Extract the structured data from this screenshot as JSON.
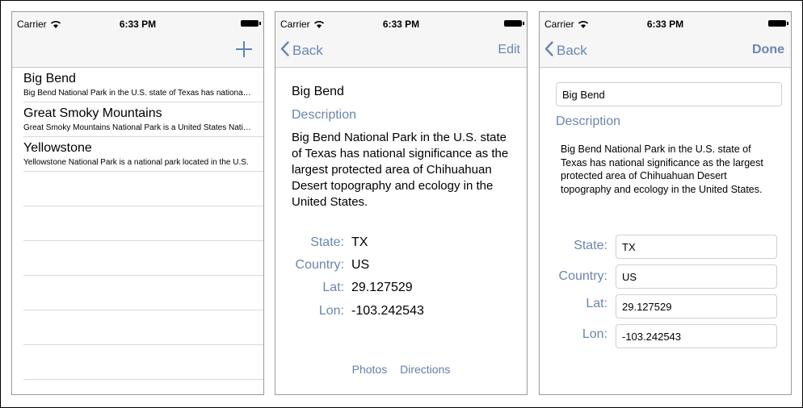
{
  "status": {
    "carrier": "Carrier",
    "time": "6:33 PM"
  },
  "list_screen": {
    "items": [
      {
        "title": "Big Bend",
        "subtitle": "Big Bend National Park in the U.S. state of Texas has national significance as the largest protected area"
      },
      {
        "title": "Great Smoky Mountains",
        "subtitle": "Great Smoky Mountains National Park is a United States National Park"
      },
      {
        "title": "Yellowstone",
        "subtitle": "Yellowstone National Park is a national park located in the U.S."
      }
    ]
  },
  "detail_screen": {
    "back_label": "Back",
    "edit_label": "Edit",
    "title": "Big Bend",
    "description_label": "Description",
    "description": "Big Bend National Park in the U.S. state of Texas has national significance as the largest protected area of Chihuahuan Desert topography and ecology in the United States.",
    "fields": [
      {
        "label": "State:",
        "value": "TX"
      },
      {
        "label": "Country:",
        "value": "US"
      },
      {
        "label": "Lat:",
        "value": "29.127529"
      },
      {
        "label": "Lon:",
        "value": "-103.242543"
      }
    ],
    "photos_label": "Photos",
    "directions_label": "Directions"
  },
  "edit_screen": {
    "back_label": "Back",
    "done_label": "Done",
    "name_value": "Big Bend",
    "description_label": "Description",
    "description": "Big Bend National Park in the U.S. state of Texas has national significance as the largest protected area of Chihuahuan Desert topography and ecology in the United States.",
    "fields": [
      {
        "label": "State:",
        "value": "TX"
      },
      {
        "label": "Country:",
        "value": "US"
      },
      {
        "label": "Lat:",
        "value": "29.127529"
      },
      {
        "label": "Lon:",
        "value": "-103.242543"
      }
    ]
  },
  "colors": {
    "accent": "#6a86ad",
    "navbar": "#f6f6f7"
  }
}
